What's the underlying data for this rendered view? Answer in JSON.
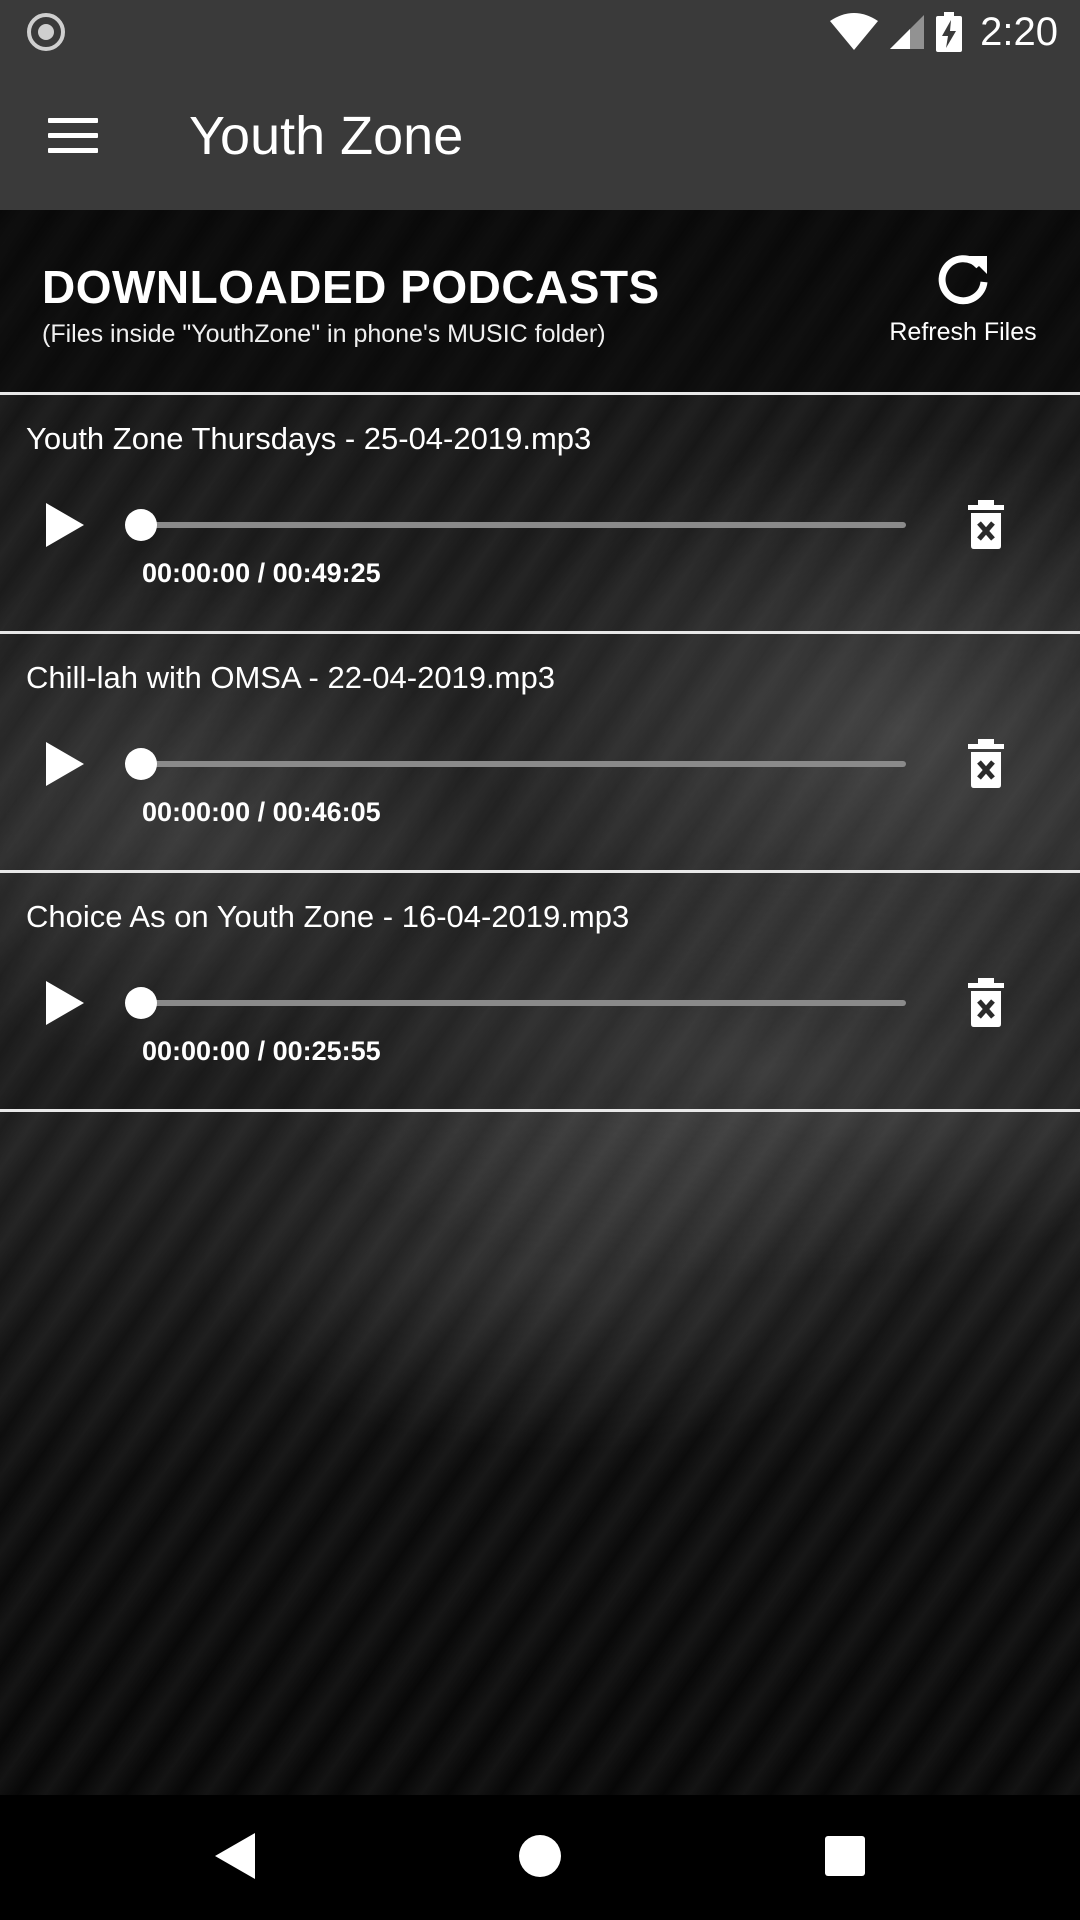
{
  "status_bar": {
    "time": "2:20",
    "icons": [
      "record-icon",
      "wifi-icon",
      "signal-icon",
      "battery-charging-icon"
    ]
  },
  "app_bar": {
    "title": "Youth Zone",
    "menu_icon": "hamburger-menu-icon"
  },
  "header": {
    "title": "DOWNLOADED PODCASTS",
    "subtitle": "(Files inside \"YouthZone\" in phone's MUSIC folder)",
    "refresh_label": "Refresh Files",
    "refresh_icon": "refresh-icon"
  },
  "podcasts": [
    {
      "title": "Youth Zone Thursdays - 25-04-2019.mp3",
      "time": "00:00:00 / 00:49:25",
      "progress": 0
    },
    {
      "title": "Chill-lah with OMSA - 22-04-2019.mp3",
      "time": "00:00:00 / 00:46:05",
      "progress": 0
    },
    {
      "title": "Choice As on Youth Zone - 16-04-2019.mp3",
      "time": "00:00:00 / 00:25:55",
      "progress": 0
    }
  ],
  "colors": {
    "app_bar": "#3a3a3a",
    "divider": "#e8e8e8",
    "text": "#ffffff"
  },
  "nav_bar": {
    "icons": [
      "back-icon",
      "home-icon",
      "recents-icon"
    ]
  }
}
